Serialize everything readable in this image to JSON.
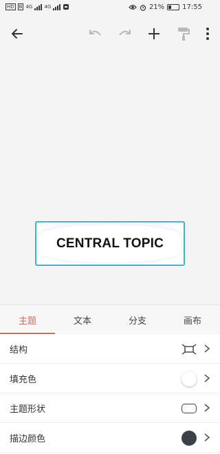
{
  "statusbar": {
    "left_tags": [
      "HD",
      "B"
    ],
    "signal_labels": [
      "4G",
      "4G"
    ],
    "battery_percent": "21%",
    "time": "17:55"
  },
  "toolbar": {
    "icons": [
      "back-arrow-icon",
      "undo-icon",
      "redo-icon",
      "add-icon",
      "format-painter-icon",
      "more-vertical-icon"
    ]
  },
  "canvas": {
    "central_topic": "CENTRAL TOPIC",
    "topic_border_color": "#3fb5c8"
  },
  "tabs": {
    "active_color": "#d9654f",
    "items": [
      {
        "label": "主题"
      },
      {
        "label": "文本"
      },
      {
        "label": "分支"
      },
      {
        "label": "画布"
      }
    ]
  },
  "settings": {
    "rows": [
      {
        "label": "结构",
        "value_icon": "structure-icon"
      },
      {
        "label": "填充色",
        "value_color": "#ffffff"
      },
      {
        "label": "主题形状",
        "value_icon": "rounded-rect-shape-icon"
      },
      {
        "label": "描边颜色",
        "value_color": "#3c4048"
      }
    ]
  }
}
